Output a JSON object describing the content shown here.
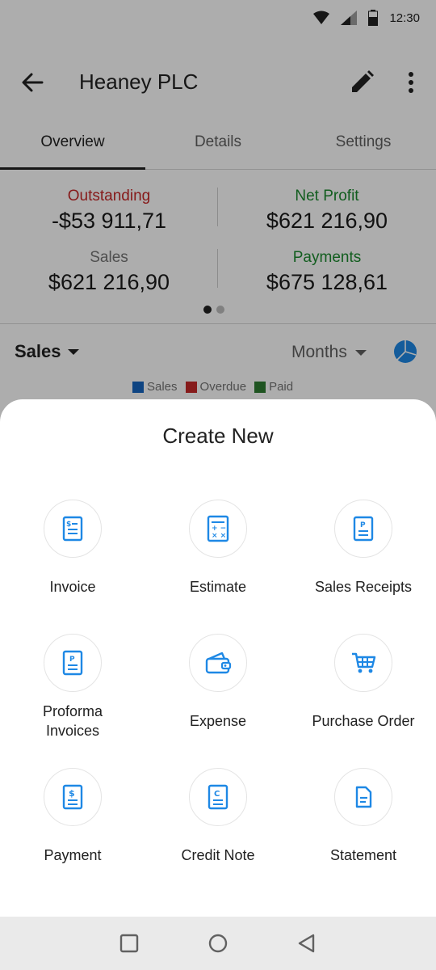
{
  "status": {
    "time": "12:30"
  },
  "app_bar": {
    "title": "Heaney PLC"
  },
  "tabs": [
    {
      "label": "Overview"
    },
    {
      "label": "Details"
    },
    {
      "label": "Settings"
    }
  ],
  "summary": {
    "outstanding": {
      "label": "Outstanding",
      "value": "-$53 911,71"
    },
    "net_profit": {
      "label": "Net Profit",
      "value": "$621 216,90"
    },
    "sales": {
      "label": "Sales",
      "value": "$621 216,90"
    },
    "payments": {
      "label": "Payments",
      "value": "$675 128,61"
    }
  },
  "chart_controls": {
    "metric": "Sales",
    "period": "Months",
    "legend": [
      {
        "label": "Sales",
        "color": "#1565c0"
      },
      {
        "label": "Overdue",
        "color": "#c62828"
      },
      {
        "label": "Paid",
        "color": "#2e7d32"
      }
    ]
  },
  "sheet": {
    "title": "Create New",
    "items": [
      {
        "label": "Invoice",
        "icon": "invoice-icon"
      },
      {
        "label": "Estimate",
        "icon": "estimate-icon"
      },
      {
        "label": "Sales Receipts",
        "icon": "sales-receipt-icon"
      },
      {
        "label_line1": "Proforma",
        "label_line2": "Invoices",
        "icon": "proforma-invoice-icon"
      },
      {
        "label": "Expense",
        "icon": "wallet-icon"
      },
      {
        "label": "Purchase Order",
        "icon": "cart-icon"
      },
      {
        "label": "Payment",
        "icon": "payment-icon"
      },
      {
        "label": "Credit Note",
        "icon": "credit-note-icon"
      },
      {
        "label": "Statement",
        "icon": "statement-icon"
      }
    ]
  },
  "colors": {
    "accent": "#1e88e5",
    "outstanding": "#c62828",
    "positive": "#1b8a2e"
  }
}
